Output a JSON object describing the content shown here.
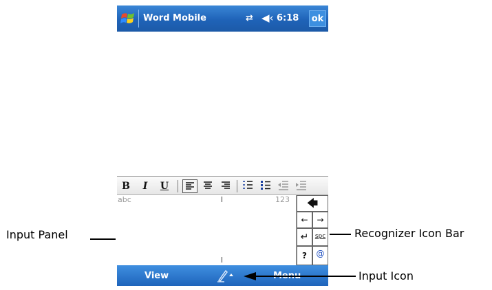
{
  "titlebar": {
    "app_title": "Word Mobile",
    "time": "6:18",
    "ok_label": "ok",
    "start_icon": "windows-flag-icon",
    "connectivity_icon": "connectivity-icon",
    "volume_icon": "speaker-icon"
  },
  "toolbar": {
    "bold": "B",
    "italic": "I",
    "underline": "U",
    "icons": [
      "align-left-icon",
      "align-center-icon",
      "align-right-icon",
      "numbered-list-icon",
      "bullet-list-icon",
      "decrease-indent-icon",
      "increase-indent-icon"
    ]
  },
  "input_panel": {
    "abc": "abc",
    "num": "123"
  },
  "recognizer": {
    "backspace": "🡄",
    "left": "←",
    "right": "→",
    "enter": "↵",
    "space": "spc",
    "help": "?",
    "symbols": "@"
  },
  "menubar": {
    "view_label": "View",
    "menu_label": "Menu"
  },
  "callouts": {
    "input_panel": "Input Panel",
    "recognizer_bar": "Recognizer Icon Bar",
    "input_icon": "Input Icon"
  },
  "colors": {
    "title_bar": "#1f63b8",
    "menu_bar": "#2a75cc"
  }
}
